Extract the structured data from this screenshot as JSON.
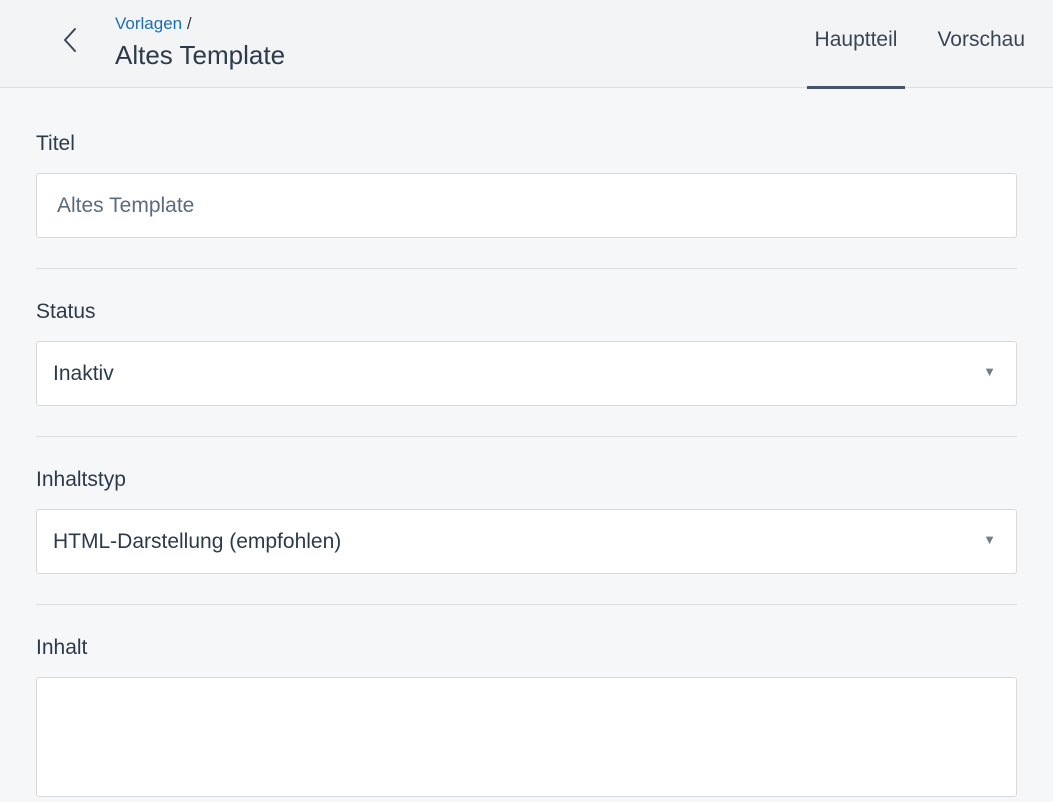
{
  "header": {
    "breadcrumb_link": "Vorlagen",
    "breadcrumb_separator": "/",
    "title": "Altes Template",
    "back_icon": "chevron-left-icon"
  },
  "tabs": [
    {
      "label": "Hauptteil",
      "active": true
    },
    {
      "label": "Vorschau",
      "active": false
    }
  ],
  "form": {
    "title_field": {
      "label": "Titel",
      "value": "Altes Template"
    },
    "status_field": {
      "label": "Status",
      "value": "Inaktiv"
    },
    "content_type_field": {
      "label": "Inhaltstyp",
      "value": "HTML-Darstellung (empfohlen)"
    },
    "content_field": {
      "label": "Inhalt",
      "value": ""
    }
  },
  "colors": {
    "link": "#1b6fb3",
    "text": "#2d3a4a",
    "active_tab_underline": "#46536a"
  }
}
